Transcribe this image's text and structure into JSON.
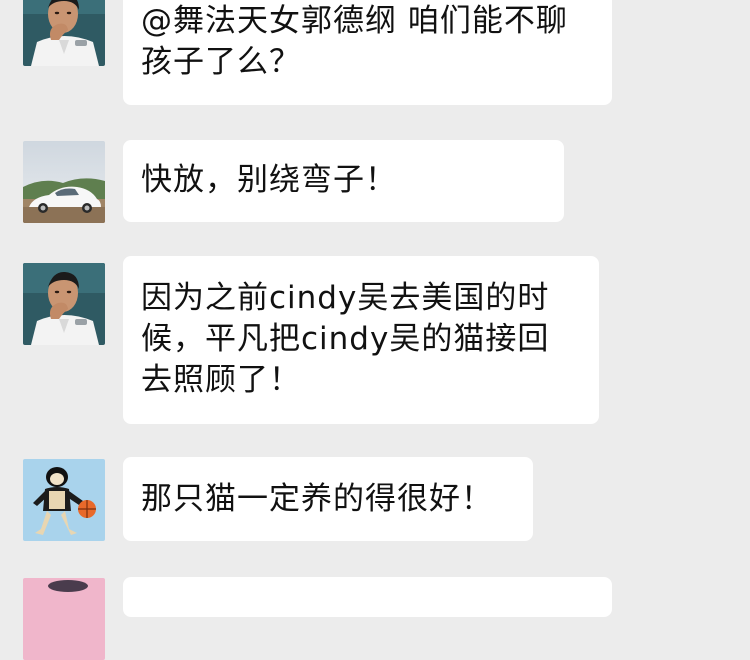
{
  "chat": {
    "messages": [
      {
        "avatar": "man-thinking-avatar",
        "text": "@舞法天女郭德纲 咱们能不聊\n孩子了么？"
      },
      {
        "avatar": "white-sports-car-avatar",
        "text": "快放，别绕弯子！"
      },
      {
        "avatar": "man-thinking-avatar",
        "text": "因为之前cindy吴去美国的时\n候，平凡把cindy吴的猫接回\n去照顾了！"
      },
      {
        "avatar": "basketball-character-avatar",
        "text": "那只猫一定养的得很好！"
      },
      {
        "avatar": "pink-avatar",
        "text": ""
      }
    ]
  },
  "colors": {
    "background": "#ececec",
    "bubble": "#ffffff",
    "text": "#111111"
  }
}
